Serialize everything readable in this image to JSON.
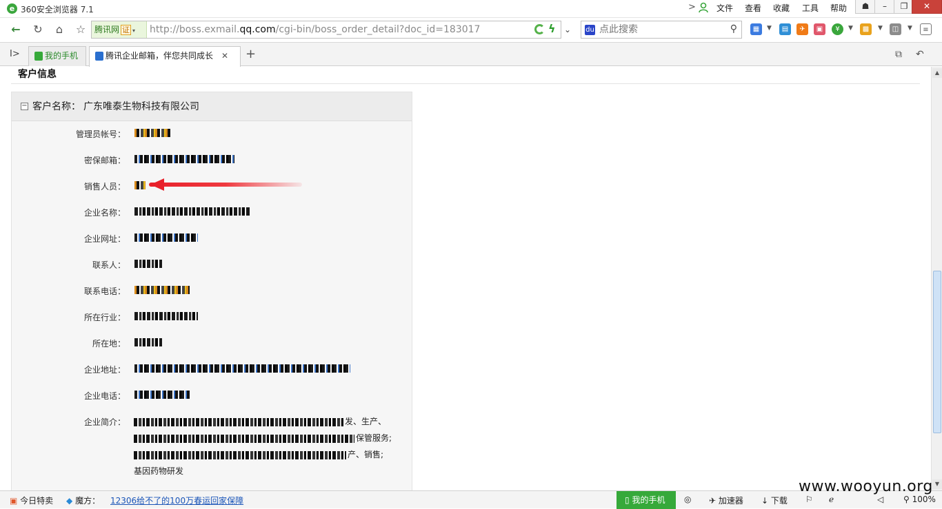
{
  "window": {
    "title": "360安全浏览器 7.1",
    "menu": [
      "文件",
      "查看",
      "收藏",
      "工具",
      "帮助"
    ],
    "controls": {
      "minimize": "–",
      "restore": "❐",
      "close": "✕"
    }
  },
  "navbar": {
    "cert_label": "腾讯网",
    "cert_badge": "证",
    "url_prefix": "http://boss.exmail.",
    "url_domain": "qq.com",
    "url_path": "/cgi-bin/boss_order_detail?doc_id=183017",
    "search_placeholder": "点此搜索"
  },
  "tabs": [
    {
      "label": "我的手机",
      "active": false
    },
    {
      "label": "腾讯企业邮箱，伴您共同成长",
      "active": true
    }
  ],
  "page": {
    "section_title": "客户信息",
    "customer_name_label": "客户名称：",
    "customer_name": "广东唯泰生物科技有限公司",
    "fields": [
      "管理员帐号：",
      "密保邮箱：",
      "销售人员：",
      "企业名称：",
      "企业网址：",
      "联系人：",
      "联系电话：",
      "所在行业：",
      "所在地：",
      "企业地址：",
      "企业电话：",
      "企业简介："
    ],
    "description_fragments": [
      "发、生产、",
      "保管服务;",
      "产、销售;",
      "基因药物研发"
    ]
  },
  "statusbar": {
    "today_deals": "今日特卖",
    "magic": "魔方：",
    "news_link": "12306给不了的100万春运回家保障",
    "my_phone": "我的手机",
    "accelerator": "加速器",
    "download": "下载",
    "zoom": "100%"
  },
  "watermark": "www.wooyun.org",
  "colors": {
    "accent_green": "#36a93a",
    "annotation_red": "#e8202a",
    "link_blue": "#1a55b8"
  }
}
